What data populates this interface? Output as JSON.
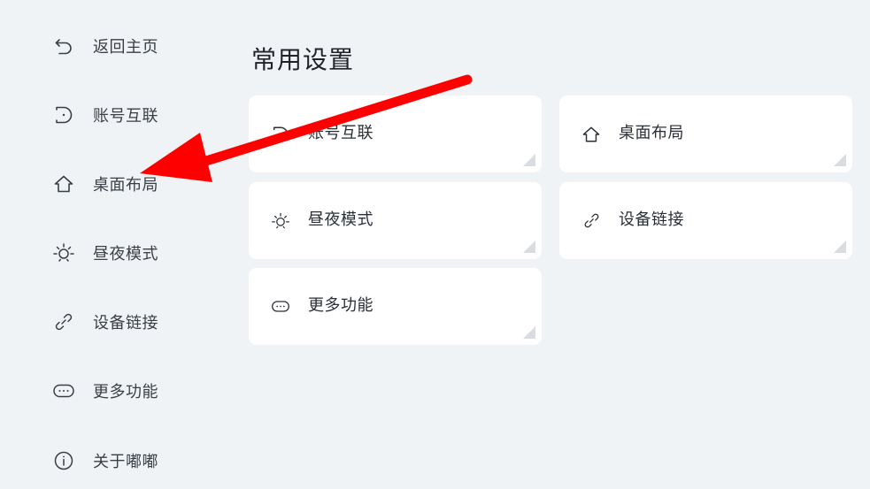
{
  "sidebar": {
    "items": [
      {
        "label": "返回主页",
        "icon": "back-icon"
      },
      {
        "label": "账号互联",
        "icon": "account-link-icon"
      },
      {
        "label": "桌面布局",
        "icon": "home-icon"
      },
      {
        "label": "昼夜模式",
        "icon": "sun-icon"
      },
      {
        "label": "设备链接",
        "icon": "link-icon"
      },
      {
        "label": "更多功能",
        "icon": "more-icon"
      },
      {
        "label": "关于嘟嘟",
        "icon": "info-icon"
      }
    ]
  },
  "main": {
    "title": "常用设置",
    "cards": [
      {
        "label": "账号互联",
        "icon": "account-link-icon"
      },
      {
        "label": "桌面布局",
        "icon": "home-icon"
      },
      {
        "label": "昼夜模式",
        "icon": "sun-icon"
      },
      {
        "label": "设备链接",
        "icon": "link-icon"
      },
      {
        "label": "更多功能",
        "icon": "more-icon"
      }
    ]
  },
  "annotation": {
    "arrow_color": "#ff0000"
  }
}
